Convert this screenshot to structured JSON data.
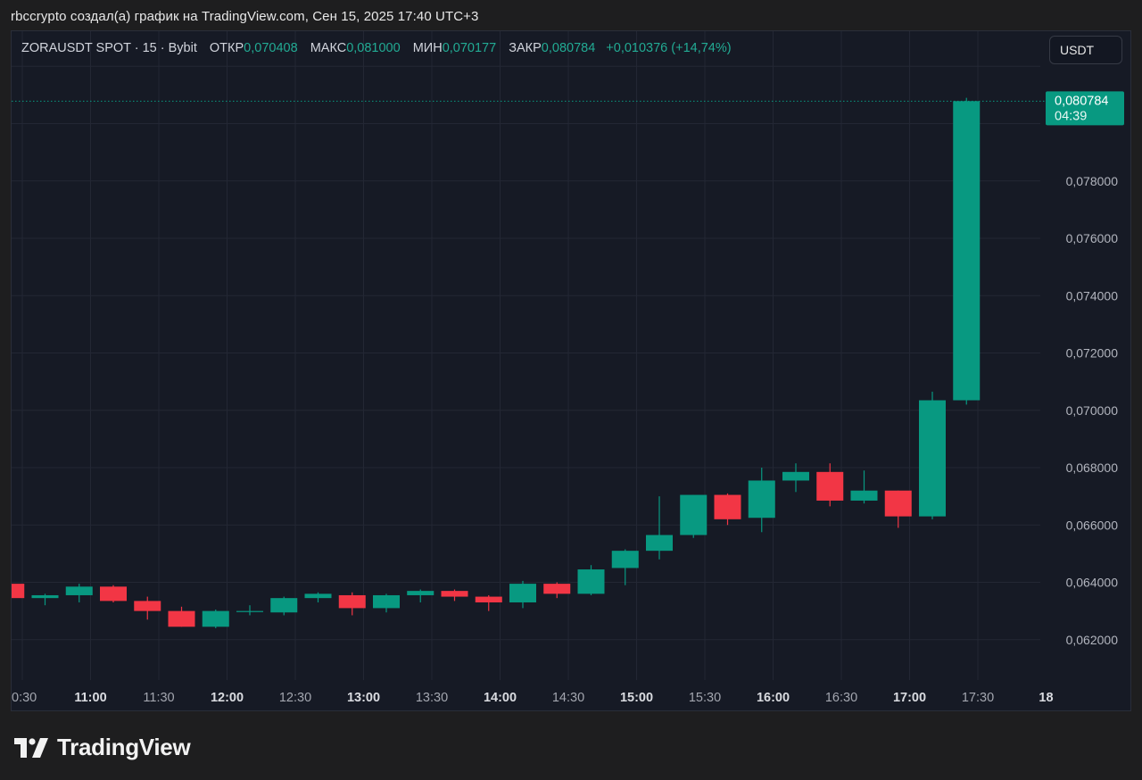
{
  "header": {
    "caption": "rbccrypto создал(а) график на TradingView.com, Сен 15, 2025 17:40 UTC+3"
  },
  "legend": {
    "symbol": "ZORAUSDT SPOT · 15 · Bybit",
    "open_label": "ОТКР",
    "open": "0,070408",
    "high_label": "МАКС",
    "high": "0,081000",
    "low_label": "МИН",
    "low": "0,070177",
    "close_label": "ЗАКР",
    "close": "0,080784",
    "change": "+0,010376 (+14,74%)"
  },
  "currency_button": {
    "label": "USDT"
  },
  "price_tag": {
    "price": "0,080784",
    "countdown": "04:39"
  },
  "footer": {
    "brand": "TradingView"
  },
  "colors": {
    "up": "#089981",
    "down": "#f23645",
    "text_up": "#22ab94"
  },
  "chart_data": {
    "type": "candlestick",
    "x_axis": {
      "ticks": [
        {
          "t": 630,
          "label": "0:30",
          "bold": false
        },
        {
          "t": 660,
          "label": "11:00",
          "bold": true
        },
        {
          "t": 690,
          "label": "11:30",
          "bold": false
        },
        {
          "t": 720,
          "label": "12:00",
          "bold": true
        },
        {
          "t": 750,
          "label": "12:30",
          "bold": false
        },
        {
          "t": 780,
          "label": "13:00",
          "bold": true
        },
        {
          "t": 810,
          "label": "13:30",
          "bold": false
        },
        {
          "t": 840,
          "label": "14:00",
          "bold": true
        },
        {
          "t": 870,
          "label": "14:30",
          "bold": false
        },
        {
          "t": 900,
          "label": "15:00",
          "bold": true
        },
        {
          "t": 930,
          "label": "15:30",
          "bold": false
        },
        {
          "t": 960,
          "label": "16:00",
          "bold": true
        },
        {
          "t": 990,
          "label": "16:30",
          "bold": false
        },
        {
          "t": 1020,
          "label": "17:00",
          "bold": true
        },
        {
          "t": 1050,
          "label": "17:30",
          "bold": false
        },
        {
          "t": 1080,
          "label": "18",
          "bold": true
        }
      ]
    },
    "y_axis": {
      "ticks": [
        0.062,
        0.064,
        0.066,
        0.068,
        0.07,
        0.072,
        0.074,
        0.076,
        0.078
      ],
      "labels": [
        "0,062000",
        "0,064000",
        "0,066000",
        "0,068000",
        "0,070000",
        "0,072000",
        "0,074000",
        "0,076000",
        "0,078000"
      ]
    },
    "last_price": 0.080784,
    "candles": [
      {
        "t": 625,
        "o": 0.06395,
        "h": 0.06405,
        "l": 0.0632,
        "c": 0.06345
      },
      {
        "t": 640,
        "o": 0.06345,
        "h": 0.0636,
        "l": 0.0632,
        "c": 0.06355
      },
      {
        "t": 655,
        "o": 0.06355,
        "h": 0.06395,
        "l": 0.0633,
        "c": 0.06385
      },
      {
        "t": 670,
        "o": 0.06385,
        "h": 0.0639,
        "l": 0.0633,
        "c": 0.06335
      },
      {
        "t": 685,
        "o": 0.06335,
        "h": 0.0635,
        "l": 0.0627,
        "c": 0.063
      },
      {
        "t": 700,
        "o": 0.063,
        "h": 0.06315,
        "l": 0.06245,
        "c": 0.06245
      },
      {
        "t": 715,
        "o": 0.06245,
        "h": 0.06305,
        "l": 0.0624,
        "c": 0.063
      },
      {
        "t": 730,
        "o": 0.063,
        "h": 0.0632,
        "l": 0.06285,
        "c": 0.063
      },
      {
        "t": 745,
        "o": 0.06295,
        "h": 0.0635,
        "l": 0.06285,
        "c": 0.06345
      },
      {
        "t": 760,
        "o": 0.06345,
        "h": 0.06365,
        "l": 0.0633,
        "c": 0.0636
      },
      {
        "t": 775,
        "o": 0.06355,
        "h": 0.06365,
        "l": 0.06285,
        "c": 0.0631
      },
      {
        "t": 790,
        "o": 0.0631,
        "h": 0.0636,
        "l": 0.06295,
        "c": 0.06355
      },
      {
        "t": 805,
        "o": 0.06355,
        "h": 0.06375,
        "l": 0.0633,
        "c": 0.0637
      },
      {
        "t": 820,
        "o": 0.0637,
        "h": 0.06375,
        "l": 0.06335,
        "c": 0.0635
      },
      {
        "t": 835,
        "o": 0.0635,
        "h": 0.06355,
        "l": 0.063,
        "c": 0.0633
      },
      {
        "t": 850,
        "o": 0.0633,
        "h": 0.06405,
        "l": 0.0631,
        "c": 0.06395
      },
      {
        "t": 865,
        "o": 0.06395,
        "h": 0.064,
        "l": 0.06345,
        "c": 0.0636
      },
      {
        "t": 880,
        "o": 0.0636,
        "h": 0.0646,
        "l": 0.06355,
        "c": 0.06445
      },
      {
        "t": 895,
        "o": 0.0645,
        "h": 0.06515,
        "l": 0.0639,
        "c": 0.0651
      },
      {
        "t": 910,
        "o": 0.0651,
        "h": 0.067,
        "l": 0.0648,
        "c": 0.06565
      },
      {
        "t": 925,
        "o": 0.06565,
        "h": 0.06705,
        "l": 0.06555,
        "c": 0.06705
      },
      {
        "t": 940,
        "o": 0.06705,
        "h": 0.0671,
        "l": 0.066,
        "c": 0.0662
      },
      {
        "t": 955,
        "o": 0.06625,
        "h": 0.068,
        "l": 0.06575,
        "c": 0.06755
      },
      {
        "t": 970,
        "o": 0.06755,
        "h": 0.06815,
        "l": 0.06715,
        "c": 0.06785
      },
      {
        "t": 985,
        "o": 0.06785,
        "h": 0.06815,
        "l": 0.06665,
        "c": 0.06685
      },
      {
        "t": 1000,
        "o": 0.06685,
        "h": 0.0679,
        "l": 0.06675,
        "c": 0.0672
      },
      {
        "t": 1015,
        "o": 0.0672,
        "h": 0.0672,
        "l": 0.0659,
        "c": 0.0663
      },
      {
        "t": 1030,
        "o": 0.0663,
        "h": 0.07065,
        "l": 0.0662,
        "c": 0.07035
      },
      {
        "t": 1045,
        "o": 0.07035,
        "h": 0.0809,
        "l": 0.0702,
        "c": 0.080784
      }
    ]
  }
}
